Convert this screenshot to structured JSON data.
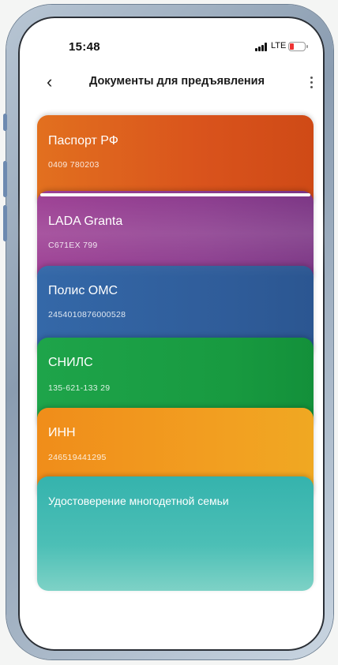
{
  "status_bar": {
    "time": "15:48",
    "network": "LTE"
  },
  "header": {
    "back_icon": "chevron-left-icon",
    "title": "Документы для предъявления",
    "menu_icon": "more-vertical-icon"
  },
  "documents": [
    {
      "name": "Паспорт РФ",
      "number": "0409 780203",
      "color": "#d9531c"
    },
    {
      "name": "LADA Granta",
      "number": "С671ЕХ 799",
      "color": "#8a3a8d"
    },
    {
      "name": "Полис ОМС",
      "number": "2454010876000528",
      "color": "#2f5c99"
    },
    {
      "name": "СНИЛС",
      "number": "135-621-133 29",
      "color": "#189a40"
    },
    {
      "name": "ИНН",
      "number": "246519441295",
      "color": "#f2a021"
    },
    {
      "name": "Удостоверение многодетной семьи",
      "color": "#4cbfb6"
    }
  ]
}
